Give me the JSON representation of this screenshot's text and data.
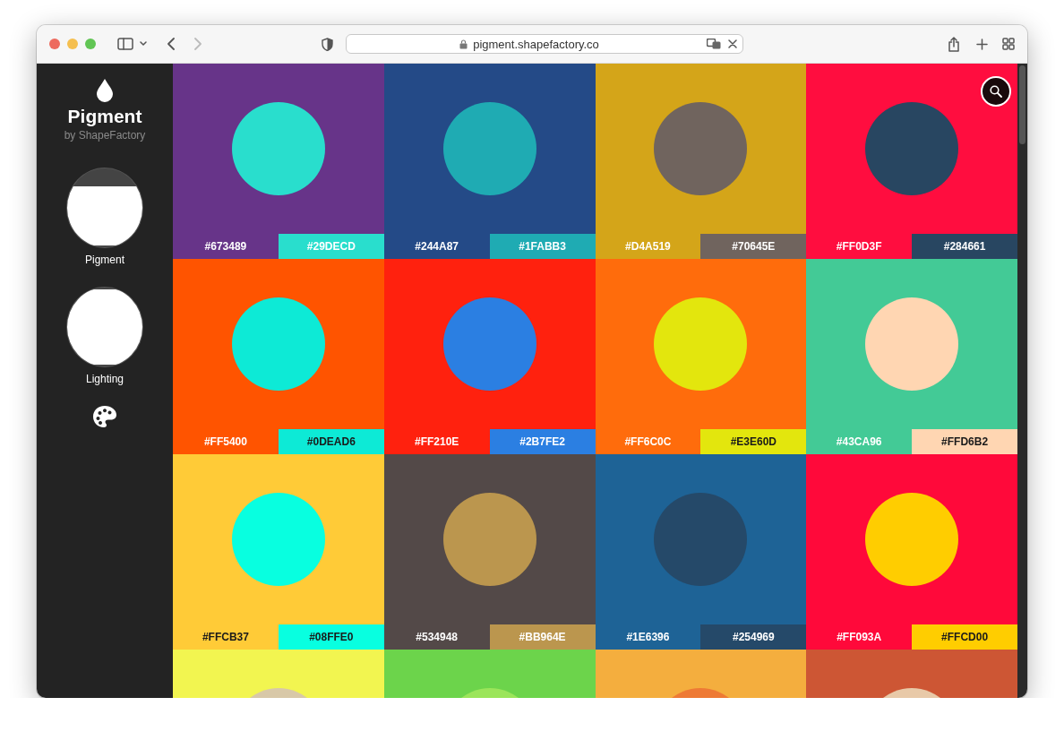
{
  "browser": {
    "url": "pigment.shapefactory.co",
    "back": {
      "disabled": false
    },
    "forward": {
      "disabled": true
    }
  },
  "sidebar": {
    "logo_title": "Pigment",
    "logo_subtitle": "by ShapeFactory",
    "dials": [
      {
        "label": "Pigment",
        "level": 0.78
      },
      {
        "label": "Lighting",
        "level": 1
      }
    ]
  },
  "tiles": [
    {
      "background": {
        "label": "#673489",
        "color": "#673489"
      },
      "circle": {
        "label": "#29DECD",
        "color": "#29DECD"
      }
    },
    {
      "background": {
        "label": "#244A87",
        "color": "#244A87"
      },
      "circle": {
        "label": "#1FABB3",
        "color": "#1FABB3"
      }
    },
    {
      "background": {
        "label": "#D4A519",
        "color": "#D4A519"
      },
      "circle": {
        "label": "#70645E",
        "color": "#70645E"
      }
    },
    {
      "background": {
        "label": "#FF0D3F",
        "color": "#FF0D3F"
      },
      "circle": {
        "label": "#284661",
        "color": "#284661"
      }
    },
    {
      "background": {
        "label": "#FF5400",
        "color": "#FF5400"
      },
      "circle": {
        "label": "#0DEAD6",
        "color": "#0DEAD6"
      }
    },
    {
      "background": {
        "label": "#FF210E",
        "color": "#FF210E"
      },
      "circle": {
        "label": "#2B7FE2",
        "color": "#2B7FE2"
      }
    },
    {
      "background": {
        "label": "#FF6C0C",
        "color": "#FF6C0C"
      },
      "circle": {
        "label": "#E3E60D",
        "color": "#E3E60D"
      }
    },
    {
      "background": {
        "label": "#43CA96",
        "color": "#43CA96"
      },
      "circle": {
        "label": "#FFD6B2",
        "color": "#FFD6B2"
      }
    },
    {
      "background": {
        "label": "#FFCB37",
        "color": "#FFCB37"
      },
      "circle": {
        "label": "#08FFE0",
        "color": "#08FFE0"
      }
    },
    {
      "background": {
        "label": "#534948",
        "color": "#534948"
      },
      "circle": {
        "label": "#BB964E",
        "color": "#BB964E"
      }
    },
    {
      "background": {
        "label": "#1E6396",
        "color": "#1E6396"
      },
      "circle": {
        "label": "#254969",
        "color": "#254969"
      }
    },
    {
      "background": {
        "label": "#FF093A",
        "color": "#FF093A"
      },
      "circle": {
        "label": "#FFCD00",
        "color": "#FFCD00"
      }
    },
    {
      "background": {
        "color": "#f2f550"
      },
      "circle": {
        "color": "#d8c8a8"
      }
    },
    {
      "background": {
        "color": "#6cd44b"
      },
      "circle": {
        "color": "#9be55a"
      }
    },
    {
      "background": {
        "color": "#f4ae3e"
      },
      "circle": {
        "color": "#ee7a35"
      }
    },
    {
      "background": {
        "color": "#cd5634"
      },
      "circle": {
        "color": "#e8c9a8"
      }
    }
  ]
}
